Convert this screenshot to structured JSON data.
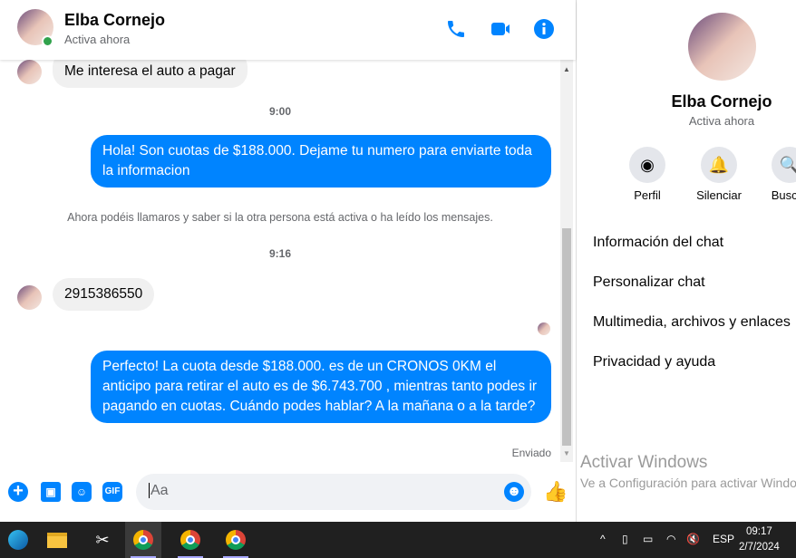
{
  "header": {
    "name": "Elba Cornejo",
    "status": "Activa ahora"
  },
  "messages": [
    {
      "type": "in",
      "text": "Me interesa el auto a pagar"
    },
    {
      "type": "time",
      "text": "9:00"
    },
    {
      "type": "out",
      "text": "Hola! Son cuotas de $188.000. Dejame tu numero para enviarte toda la informacion"
    },
    {
      "type": "note",
      "text": "Ahora podéis llamaros y saber si la otra persona está activa o ha leído los mensajes."
    },
    {
      "type": "time",
      "text": "9:16"
    },
    {
      "type": "in",
      "text": "2915386550"
    },
    {
      "type": "out",
      "text": "Perfecto! La cuota desde $188.000. es de un CRONOS 0KM el anticipo para retirar el auto es de $6.743.700 , mientras tanto podes ir pagando en cuotas. Cuándo podes hablar? A la mañana o a la tarde?"
    }
  ],
  "sent_status": "Enviado",
  "compose": {
    "placeholder": "Aa",
    "gif": "GIF"
  },
  "side": {
    "name": "Elba Cornejo",
    "status": "Activa ahora",
    "actions": [
      "Perfil",
      "Silenciar",
      "Buscar"
    ],
    "menu": [
      "Información del chat",
      "Personalizar chat",
      "Multimedia, archivos y enlaces",
      "Privacidad y ayuda"
    ]
  },
  "watermark": {
    "title": "Activar Windows",
    "subtitle": "Ve a Configuración para activar Windows."
  },
  "taskbar": {
    "lang": "ESP",
    "time": "09:17",
    "date": "2/7/2024"
  }
}
